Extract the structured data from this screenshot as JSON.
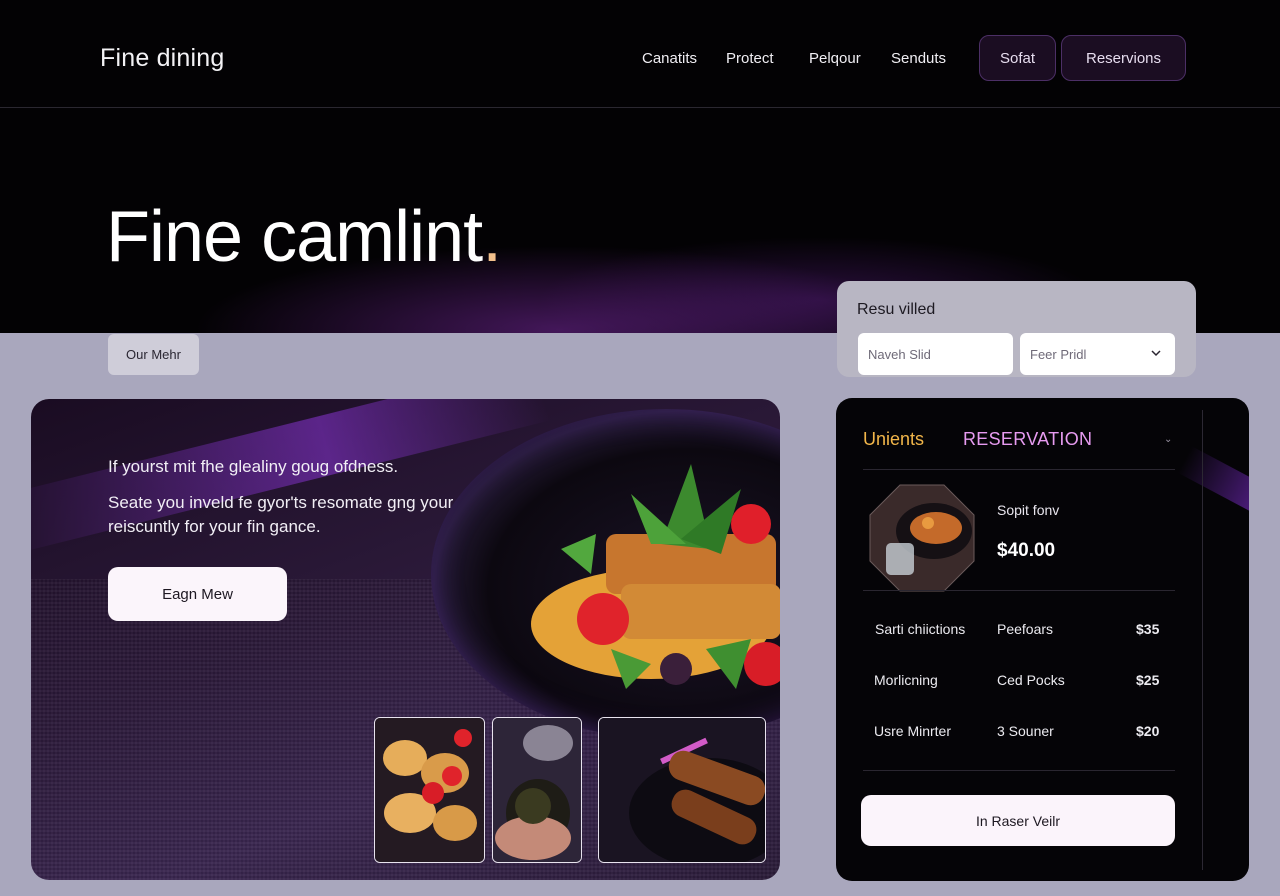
{
  "nav": {
    "brand": "Fine dining",
    "links": [
      "Canatits",
      "Protect",
      "Pelqour",
      "Senduts"
    ],
    "button_secondary": "Sofat",
    "button_primary": "Reservions"
  },
  "hero": {
    "title": "Fine camlint",
    "title_dot": ".",
    "chip": "Our Mehr",
    "line1": "If yourst mit fhe glealiny goug ofdness.",
    "line2": "Seate you inveld fe gyor'ts resomate gng your reiscuntly for your fin gance.",
    "cta": "Eagn Mew"
  },
  "search": {
    "title": "Resu villed",
    "field1_placeholder": "Naveh Slid",
    "field2_value": "Feer Pridl"
  },
  "reservation": {
    "tab1": "Unients",
    "tab2": "RESERVATION",
    "tab_more": "⌄",
    "featured": {
      "name": "Sopit fonv",
      "price": "$40.00"
    },
    "rows": [
      {
        "name": "Sarti chiictions",
        "category": "Peefoars",
        "price": "$35"
      },
      {
        "name": "Morlicning",
        "category": "Ced Pocks",
        "price": "$25"
      },
      {
        "name": "Usre Minrter",
        "category": "3 Souner",
        "price": "$20"
      }
    ],
    "cta": "In Raser Veilr"
  },
  "colors": {
    "accent_orange": "#f2b64a",
    "accent_pink": "#e79bf0",
    "brand_purple": "#4c2f66",
    "title_dot": "#f2c08c"
  }
}
